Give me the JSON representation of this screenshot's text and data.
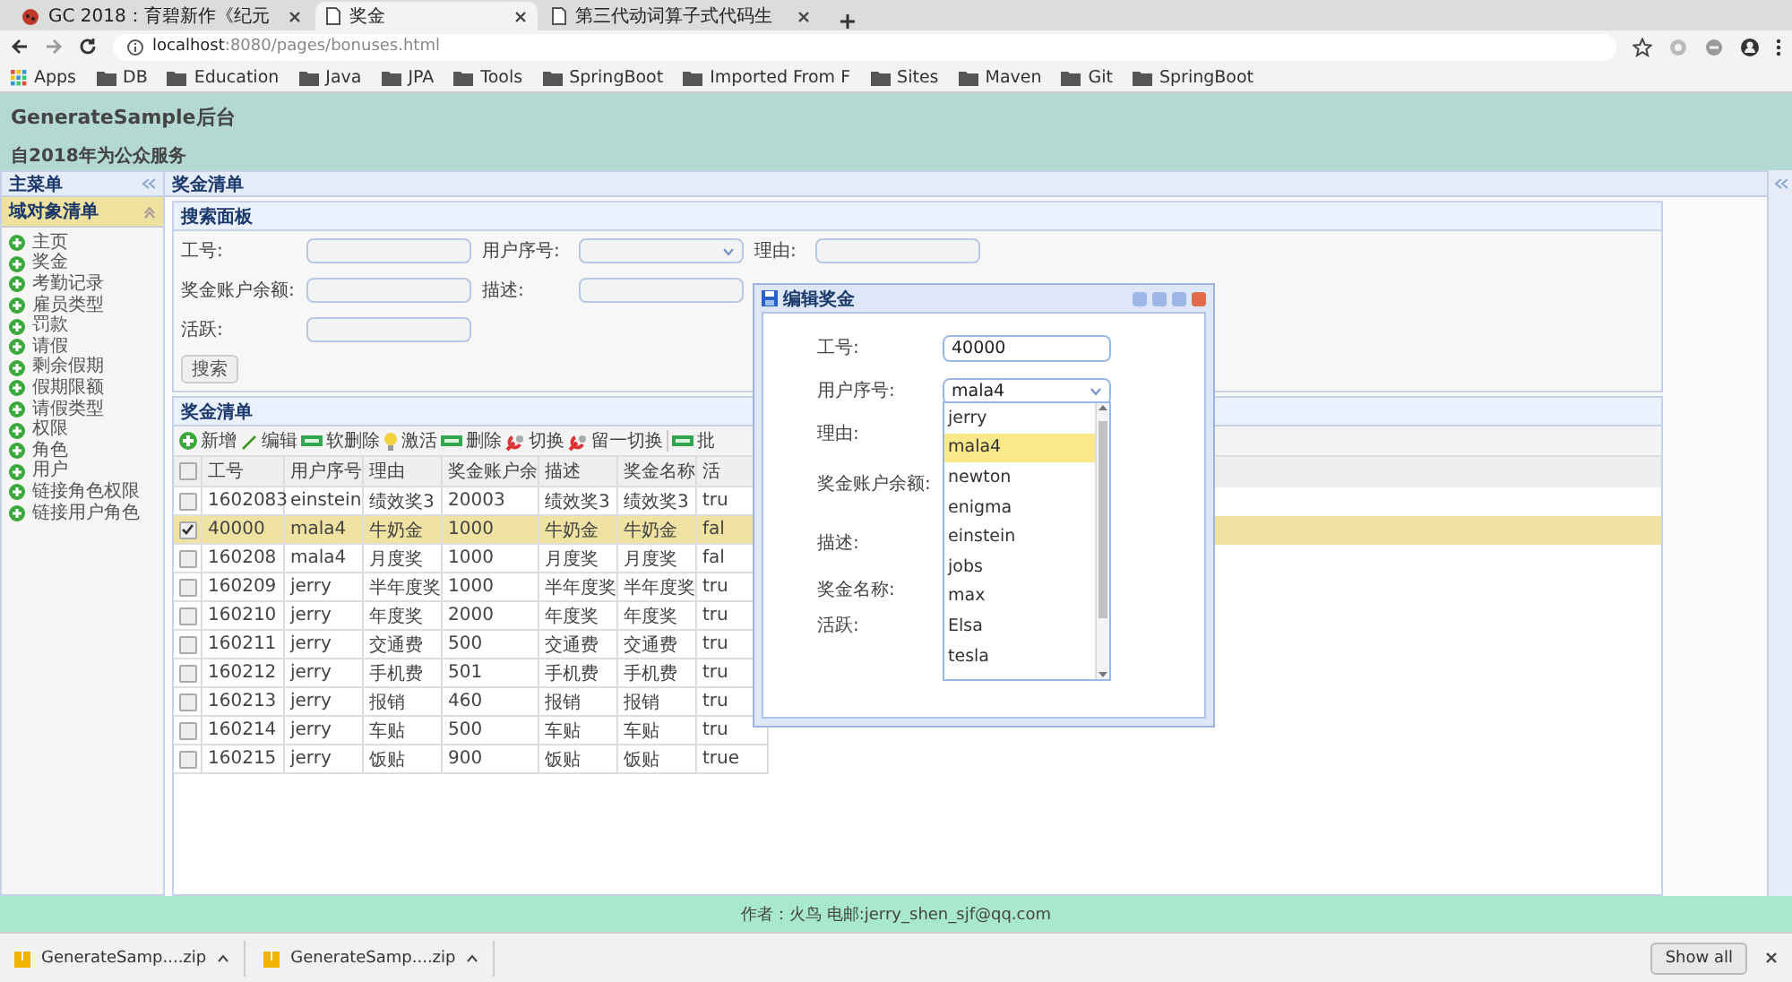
{
  "browser": {
    "tabs": [
      {
        "label": "GC 2018：育碧新作《纪元",
        "kind": "site",
        "selected": false
      },
      {
        "label": "奖金",
        "kind": "page",
        "selected": true
      },
      {
        "label": "第三代动词算子式代码生",
        "kind": "page",
        "selected": false
      }
    ],
    "address": {
      "host": "localhost",
      "path": ":8080/pages/bonuses.html"
    },
    "bookmarks": [
      {
        "label": "Apps",
        "kind": "apps"
      },
      {
        "label": "DB",
        "kind": "folder"
      },
      {
        "label": "Education",
        "kind": "folder"
      },
      {
        "label": "Java",
        "kind": "folder"
      },
      {
        "label": "JPA",
        "kind": "folder"
      },
      {
        "label": "Tools",
        "kind": "folder"
      },
      {
        "label": "SpringBoot",
        "kind": "folder"
      },
      {
        "label": "Imported From F",
        "kind": "folder"
      },
      {
        "label": "Sites",
        "kind": "folder"
      },
      {
        "label": "Maven",
        "kind": "folder"
      },
      {
        "label": "Git",
        "kind": "folder"
      },
      {
        "label": "SpringBoot",
        "kind": "folder"
      }
    ]
  },
  "app": {
    "title": "GenerateSample后台",
    "subtitle": "自2018年为公众服务"
  },
  "sidebar": {
    "title": "主菜单",
    "section": "域对象清单",
    "items": [
      "主页",
      "奖金",
      "考勤记录",
      "雇员类型",
      "罚款",
      "请假",
      "剩余假期",
      "假期限额",
      "请假类型",
      "权限",
      "角色",
      "用户",
      "链接角色权限",
      "链接用户角色"
    ]
  },
  "main": {
    "title": "奖金清单",
    "search": {
      "title": "搜索面板",
      "rows": [
        [
          {
            "label": "工号:",
            "kind": "text"
          },
          {
            "label": "用户序号:",
            "kind": "combo"
          },
          {
            "label": "理由:",
            "kind": "text"
          }
        ],
        [
          {
            "label": "奖金账户余额:",
            "kind": "text"
          },
          {
            "label": "描述:",
            "kind": "text"
          }
        ],
        [
          {
            "label": "活跃:",
            "kind": "text"
          }
        ]
      ],
      "button": "搜索"
    },
    "grid": {
      "title": "奖金清单",
      "select_all": {
        "checked": false
      },
      "toolbar": [
        {
          "label": "新增",
          "kind": "add"
        },
        {
          "label": "编辑",
          "kind": "edit"
        },
        {
          "label": "软删除",
          "kind": "bar"
        },
        {
          "label": "激活",
          "kind": "bulb"
        },
        {
          "label": "删除",
          "kind": "bar"
        },
        {
          "label": "切换",
          "kind": "switch"
        },
        {
          "label": "留一切换",
          "kind": "switch"
        },
        {
          "label": "批",
          "kind": "bar"
        }
      ],
      "columns": [
        "工号",
        "用户序号",
        "理由",
        "奖金账户余",
        "描述",
        "奖金名称",
        "活"
      ],
      "rows": [
        {
          "selected": false,
          "cells": [
            "1602083",
            "einstein",
            "绩效奖3",
            "20003",
            "绩效奖3",
            "绩效奖3",
            "tru"
          ]
        },
        {
          "selected": true,
          "cells": [
            "40000",
            "mala4",
            "牛奶金",
            "1000",
            "牛奶金",
            "牛奶金",
            "fal"
          ]
        },
        {
          "selected": false,
          "cells": [
            "160208",
            "mala4",
            "月度奖",
            "1000",
            "月度奖",
            "月度奖",
            "fal"
          ]
        },
        {
          "selected": false,
          "cells": [
            "160209",
            "jerry",
            "半年度奖",
            "1000",
            "半年度奖",
            "半年度奖",
            "tru"
          ]
        },
        {
          "selected": false,
          "cells": [
            "160210",
            "jerry",
            "年度奖",
            "2000",
            "年度奖",
            "年度奖",
            "tru"
          ]
        },
        {
          "selected": false,
          "cells": [
            "160211",
            "jerry",
            "交通费",
            "500",
            "交通费",
            "交通费",
            "tru"
          ]
        },
        {
          "selected": false,
          "cells": [
            "160212",
            "jerry",
            "手机费",
            "501",
            "手机费",
            "手机费",
            "tru"
          ]
        },
        {
          "selected": false,
          "cells": [
            "160213",
            "jerry",
            "报销",
            "460",
            "报销",
            "报销",
            "tru"
          ]
        },
        {
          "selected": false,
          "cells": [
            "160214",
            "jerry",
            "车贴",
            "500",
            "车贴",
            "车贴",
            "tru"
          ]
        },
        {
          "selected": false,
          "cells": [
            "160215",
            "jerry",
            "饭贴",
            "900",
            "饭贴",
            "饭贴",
            "true"
          ]
        }
      ]
    }
  },
  "dialog": {
    "title": "编辑奖金",
    "fields": [
      {
        "label": "工号:",
        "kind": "text",
        "value": "40000"
      },
      {
        "label": "用户序号:",
        "kind": "combo",
        "value": "mala4"
      },
      {
        "label": "理由:"
      },
      {
        "label": "奖金账户余额:"
      },
      {
        "label": "描述:"
      },
      {
        "label": "奖金名称:"
      },
      {
        "label": "活跃:"
      }
    ],
    "dropdown": [
      {
        "label": "jerry",
        "selected": false
      },
      {
        "label": "mala4",
        "selected": true
      },
      {
        "label": "newton",
        "selected": false
      },
      {
        "label": "enigma",
        "selected": false
      },
      {
        "label": "einstein",
        "selected": false
      },
      {
        "label": "jobs",
        "selected": false
      },
      {
        "label": "max",
        "selected": false
      },
      {
        "label": "Elsa",
        "selected": false
      },
      {
        "label": "tesla",
        "selected": false
      }
    ]
  },
  "footer": "作者：火鸟 电邮:jerry_shen_sjf@qq.com",
  "downloads": {
    "items": [
      "GenerateSamp....zip",
      "GenerateSamp....zip"
    ],
    "button": "Show all"
  }
}
